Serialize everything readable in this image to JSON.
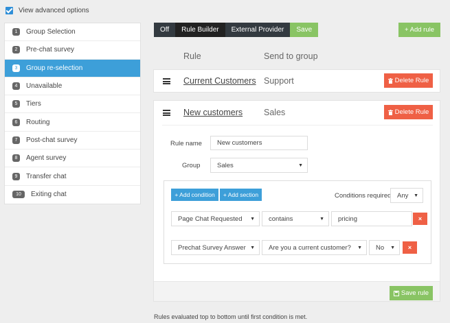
{
  "advanced": {
    "label": "View advanced options"
  },
  "sidebar": {
    "items": [
      {
        "num": "1",
        "label": "Group Selection"
      },
      {
        "num": "2",
        "label": "Pre-chat survey"
      },
      {
        "num": "3",
        "label": "Group re-selection"
      },
      {
        "num": "4",
        "label": "Unavailable"
      },
      {
        "num": "5",
        "label": "Tiers"
      },
      {
        "num": "6",
        "label": "Routing"
      },
      {
        "num": "7",
        "label": "Post-chat survey"
      },
      {
        "num": "8",
        "label": "Agent survey"
      },
      {
        "num": "9",
        "label": "Transfer chat"
      },
      {
        "num": "10",
        "label": "Exiting chat"
      }
    ]
  },
  "toolbar": {
    "off": "Off",
    "rule_builder": "Rule Builder",
    "external_provider": "External Provider",
    "save": "Save"
  },
  "add_rule": "+ Add rule",
  "headers": {
    "rule": "Rule",
    "send_to": "Send to group"
  },
  "rules": [
    {
      "name": "Current Customers",
      "group": "Support",
      "delete": "Delete Rule"
    },
    {
      "name": "New customers",
      "group": "Sales",
      "delete": "Delete Rule"
    }
  ],
  "editor": {
    "rule_name_label": "Rule name",
    "rule_name_value": "New customers",
    "group_label": "Group",
    "group_value": "Sales",
    "add_condition": "+ Add condition",
    "add_section": "+ Add section",
    "conditions_required_label": "Conditions required",
    "conditions_required_value": "Any",
    "conditions": [
      {
        "field": "Page Chat Requested",
        "op": "contains",
        "value": "pricing"
      },
      {
        "field": "Prechat Survey Answer",
        "op": "Are you a current customer?",
        "value": "No"
      }
    ],
    "remove": "×",
    "save_rule": "Save rule"
  },
  "footer_note": "Rules evaluated top to bottom until first condition is met.",
  "colors": {
    "accent_blue": "#3d9fd9",
    "green": "#89c464",
    "red": "#ef6045",
    "dark": "#333a40"
  },
  "icons": {
    "checkbox": "checkbox-checked-icon",
    "menu": "hamburger-icon",
    "trash": "trash-icon",
    "caret": "caret-down-icon"
  }
}
